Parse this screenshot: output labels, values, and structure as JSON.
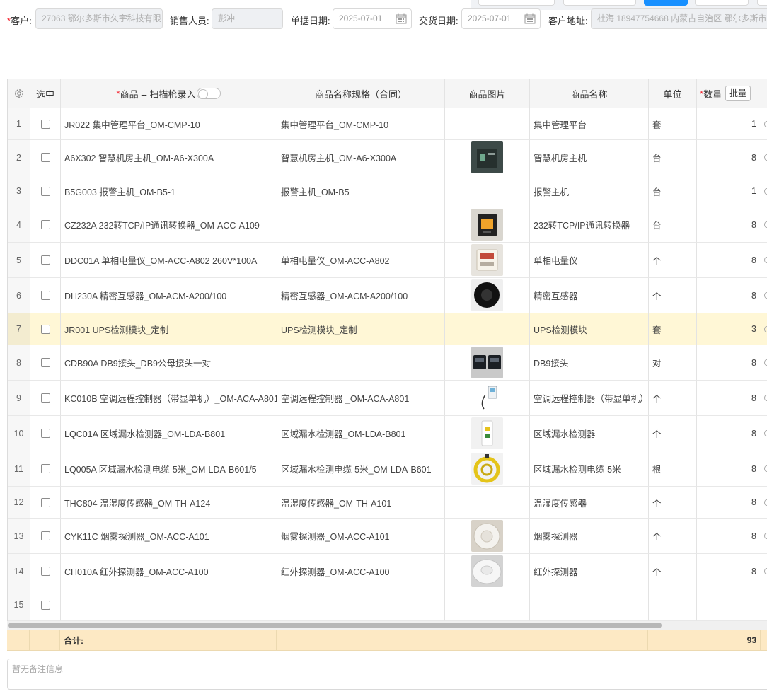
{
  "form": {
    "customer_label": "客户:",
    "customer_value": "27063 鄂尔多斯市久宇科技有限",
    "sales_label": "销售人员:",
    "sales_value": "彭冲",
    "order_date_label": "单据日期:",
    "order_date_value": "2025-07-01",
    "delivery_date_label": "交货日期:",
    "delivery_date_value": "2025-07-01",
    "address_label": "客户地址:",
    "address_value": "杜海 18947754668 内蒙古自治区 鄂尔多斯市"
  },
  "table": {
    "headers": {
      "select": "选中",
      "product_prefix": "商品 -- 扫描枪录入",
      "spec": "商品名称规格（合同）",
      "image": "商品图片",
      "name": "商品名称",
      "unit": "单位",
      "qty": "数量",
      "batch_button": "批量"
    },
    "rows": [
      {
        "no": "1",
        "product": "JR022 集中管理平台_OM-CMP-10",
        "spec": "集中管理平台_OM-CMP-10",
        "image": "",
        "name": "集中管理平台",
        "unit": "套",
        "qty": "1"
      },
      {
        "no": "2",
        "product": "A6X302 智慧机房主机_OM-A6-X300A",
        "spec": "智慧机房主机_OM-A6-X300A",
        "image": "server-photo",
        "name": "智慧机房主机",
        "unit": "台",
        "qty": "8"
      },
      {
        "no": "3",
        "product": "B5G003 报警主机_OM-B5-1",
        "spec": "报警主机_OM-B5",
        "image": "",
        "name": "报警主机",
        "unit": "台",
        "qty": "1"
      },
      {
        "no": "4",
        "product": "CZ232A 232转TCP/IP通讯转换器_OM-ACC-A109",
        "spec": "",
        "image": "converter-photo",
        "name": "232转TCP/IP通讯转换器",
        "unit": "台",
        "qty": "8"
      },
      {
        "no": "5",
        "product": "DDC01A 单相电量仪_OM-ACC-A802 260V*100A",
        "spec": "单相电量仪_OM-ACC-A802",
        "image": "meter-photo",
        "name": "单相电量仪",
        "unit": "个",
        "qty": "8"
      },
      {
        "no": "6",
        "product": "DH230A 精密互感器_OM-ACM-A200/100",
        "spec": "精密互感器_OM-ACM-A200/100",
        "image": "transformer-photo",
        "name": "精密互感器",
        "unit": "个",
        "qty": "8"
      },
      {
        "no": "7",
        "product": "JR001 UPS检测模块_定制",
        "spec": "UPS检测模块_定制",
        "image": "",
        "name": "UPS检测模块",
        "unit": "套",
        "qty": "3",
        "selected": true
      },
      {
        "no": "8",
        "product": "CDB90A DB9接头_DB9公母接头一对",
        "spec": "",
        "image": "db9-photo",
        "name": "DB9接头",
        "unit": "对",
        "qty": "8"
      },
      {
        "no": "9",
        "product": "KC010B 空调远程控制器（带显单机）_OM-ACA-A801",
        "spec": "空调远程控制器 _OM-ACA-A801",
        "image": "ac-controller-photo",
        "name": "空调远程控制器（带显单机）",
        "unit": "个",
        "qty": "8"
      },
      {
        "no": "10",
        "product": "LQC01A 区域漏水检测器_OM-LDA-B801",
        "spec": "区域漏水检测器_OM-LDA-B801",
        "image": "leak-detector-photo",
        "name": "区域漏水检测器",
        "unit": "个",
        "qty": "8"
      },
      {
        "no": "11",
        "product": "LQ005A 区域漏水检测电缆-5米_OM-LDA-B601/5",
        "spec": "区域漏水检测电缆-5米_OM-LDA-B601",
        "image": "leak-cable-photo",
        "name": "区域漏水检测电缆-5米",
        "unit": "根",
        "qty": "8"
      },
      {
        "no": "12",
        "product": "THC804 温湿度传感器_OM-TH-A124",
        "spec": "温湿度传感器_OM-TH-A101",
        "image": "",
        "name": "温湿度传感器",
        "unit": "个",
        "qty": "8"
      },
      {
        "no": "13",
        "product": "CYK11C 烟雾探测器_OM-ACC-A101",
        "spec": "烟雾探测器_OM-ACC-A101",
        "image": "smoke-detector-photo",
        "name": "烟雾探测器",
        "unit": "个",
        "qty": "8"
      },
      {
        "no": "14",
        "product": "CH010A 红外探测器_OM-ACC-A100",
        "spec": "红外探测器_OM-ACC-A100",
        "image": "infrared-detector-photo",
        "name": "红外探测器",
        "unit": "个",
        "qty": "8"
      },
      {
        "no": "15",
        "product": "",
        "spec": "",
        "image": "",
        "name": "",
        "unit": "",
        "qty": ""
      }
    ],
    "footer": {
      "label": "合计:",
      "total_qty": "93"
    }
  },
  "remark": {
    "placeholder": "暂无备注信息"
  },
  "colors": {
    "required": "#f5222d",
    "selected_row": "#fff7d6",
    "footer": "#fde9c4",
    "primary": "#1890ff"
  }
}
